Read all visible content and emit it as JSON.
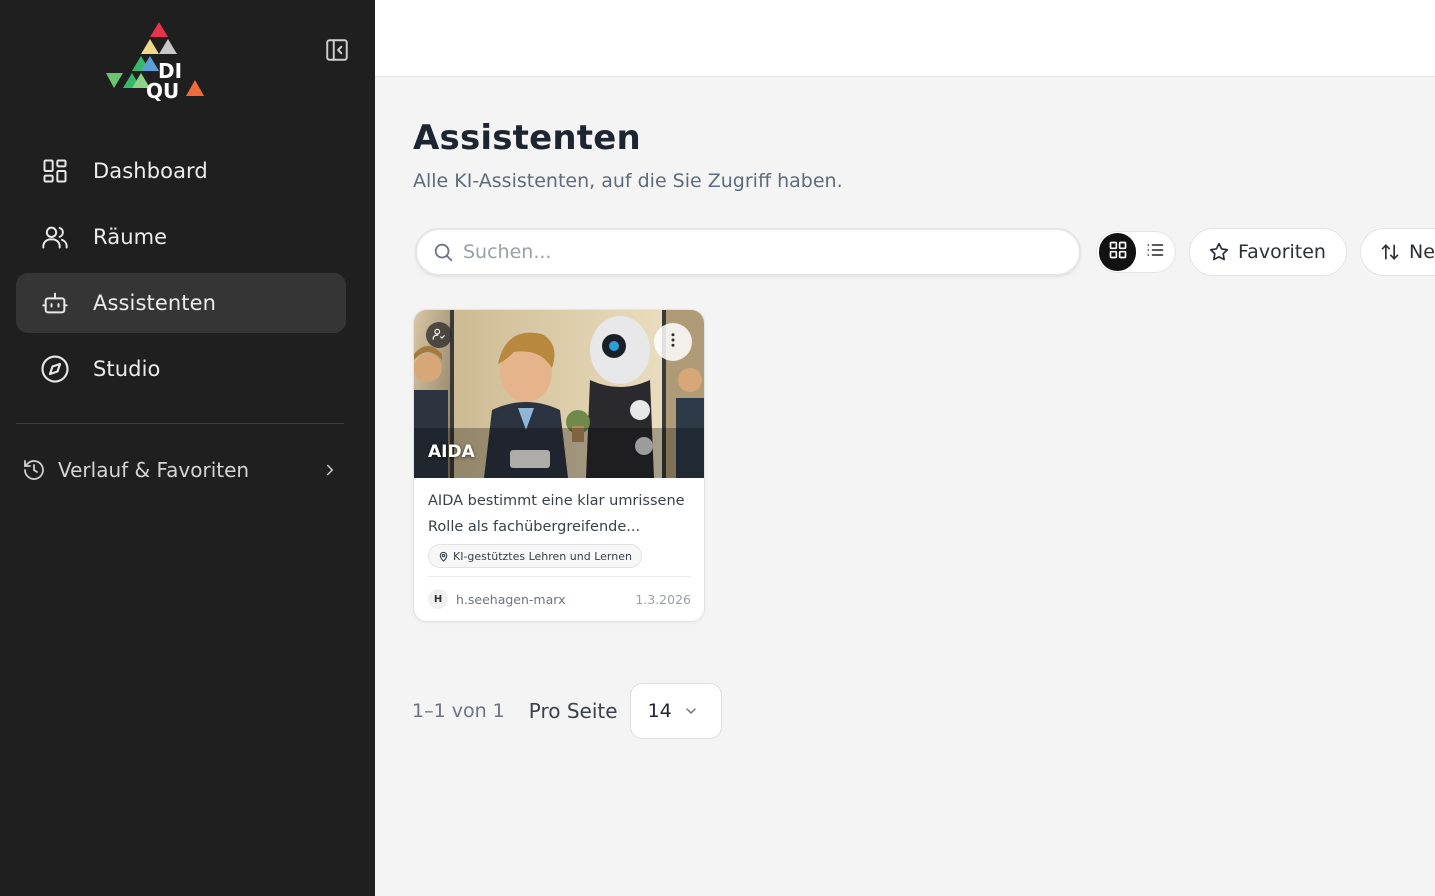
{
  "sidebar": {
    "logo_text_line1": "DI",
    "logo_text_line2": "QU",
    "nav": [
      {
        "label": "Dashboard",
        "icon": "dashboard-icon",
        "active": false
      },
      {
        "label": "Räume",
        "icon": "users-icon",
        "active": false
      },
      {
        "label": "Assistenten",
        "icon": "robot-icon",
        "active": true
      },
      {
        "label": "Studio",
        "icon": "compass-icon",
        "active": false
      }
    ],
    "history_label": "Verlauf & Favoriten"
  },
  "main": {
    "title": "Assistenten",
    "subtitle": "Alle KI-Assistenten, auf die Sie Zugriff haben.",
    "search_placeholder": "Suchen...",
    "favorites_label": "Favoriten",
    "sort_label": "Ne"
  },
  "cards": [
    {
      "name": "AIDA",
      "description": "AIDA bestimmt eine klar umrissene Rolle als fachübergreifende...",
      "tag": "KI-gestütztes Lehren und Lernen",
      "author_initial": "H",
      "author": "h.seehagen-marx",
      "date": "1.3.2026"
    }
  ],
  "pagination": {
    "range": "1–1 von 1",
    "per_page_label": "Pro Seite",
    "per_page_value": "14"
  },
  "colors": {
    "sidebar_bg": "#1f1f1f",
    "active_bg": "#353535",
    "main_bg": "#f4f4f4",
    "toggle_on": "#121212"
  }
}
